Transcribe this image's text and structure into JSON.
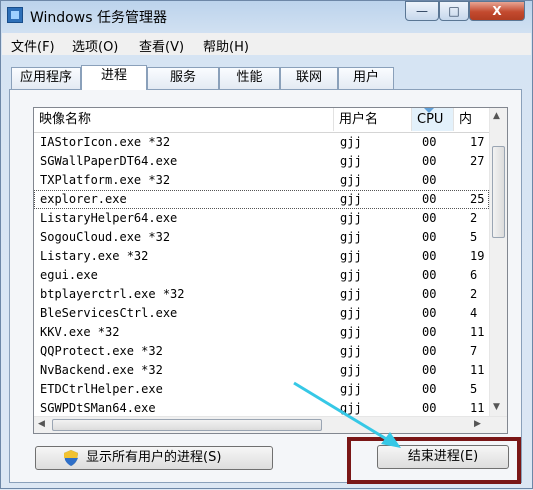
{
  "window": {
    "title": "Windows 任务管理器",
    "minimize_label": "—",
    "maximize_label": "□",
    "close_label": "X"
  },
  "menu": [
    "文件(F)",
    "选项(O)",
    "查看(V)",
    "帮助(H)"
  ],
  "tabs": [
    "应用程序",
    "进程",
    "服务",
    "性能",
    "联网",
    "用户"
  ],
  "active_tab": "进程",
  "columns": {
    "name": "映像名称",
    "user": "用户名",
    "cpu": "CPU",
    "mem": "内"
  },
  "sorted_column": "cpu",
  "processes": [
    {
      "name": "IAStorIcon.exe *32",
      "user": "gjj",
      "cpu": "00",
      "mem": "17"
    },
    {
      "name": "SGWallPaperDT64.exe",
      "user": "gjj",
      "cpu": "00",
      "mem": "27"
    },
    {
      "name": "TXPlatform.exe *32",
      "user": "gjj",
      "cpu": "00",
      "mem": ""
    },
    {
      "name": "explorer.exe",
      "user": "gjj",
      "cpu": "00",
      "mem": "25",
      "selected": true
    },
    {
      "name": "ListaryHelper64.exe",
      "user": "gjj",
      "cpu": "00",
      "mem": "2"
    },
    {
      "name": "SogouCloud.exe *32",
      "user": "gjj",
      "cpu": "00",
      "mem": "5"
    },
    {
      "name": "Listary.exe *32",
      "user": "gjj",
      "cpu": "00",
      "mem": "19"
    },
    {
      "name": "egui.exe",
      "user": "gjj",
      "cpu": "00",
      "mem": "6"
    },
    {
      "name": "btplayerctrl.exe *32",
      "user": "gjj",
      "cpu": "00",
      "mem": "2"
    },
    {
      "name": "BleServicesCtrl.exe",
      "user": "gjj",
      "cpu": "00",
      "mem": "4"
    },
    {
      "name": "KKV.exe *32",
      "user": "gjj",
      "cpu": "00",
      "mem": "11"
    },
    {
      "name": "QQProtect.exe *32",
      "user": "gjj",
      "cpu": "00",
      "mem": "7"
    },
    {
      "name": "NvBackend.exe *32",
      "user": "gjj",
      "cpu": "00",
      "mem": "11"
    },
    {
      "name": "ETDCtrlHelper.exe",
      "user": "gjj",
      "cpu": "00",
      "mem": "5"
    },
    {
      "name": "SGWPDtSMan64.exe",
      "user": "gjj",
      "cpu": "00",
      "mem": "11"
    }
  ],
  "buttons": {
    "show_all": "显示所有用户的进程(S)",
    "end_process": "结束进程(E)"
  },
  "colors": {
    "highlight_box": "#7a1717",
    "arrow": "#36c8e6",
    "shield_blue": "#2f6fc8",
    "shield_yellow": "#f1c232"
  },
  "icons": [
    "app-icon",
    "minimize-icon",
    "maximize-icon",
    "close-icon",
    "sort-icon",
    "scroll-up-icon",
    "scroll-down-icon",
    "scroll-left-icon",
    "scroll-right-icon",
    "uac-shield-icon",
    "annotation-arrow-icon"
  ]
}
